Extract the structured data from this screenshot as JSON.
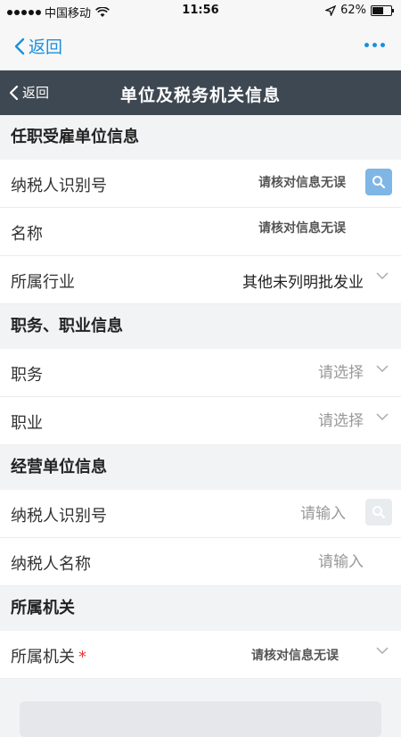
{
  "status_bar": {
    "carrier": "中国移动",
    "time": "11:56",
    "battery_text": "62%",
    "battery_level": 0.62
  },
  "top_nav": {
    "back_label": "返回"
  },
  "app_nav": {
    "back_label": "返回",
    "title": "单位及税务机关信息"
  },
  "sections": {
    "employer": {
      "title": "任职受雇单位信息",
      "taxpayer_id_label": "纳税人识别号",
      "taxpayer_id_value": "请核对信息无误",
      "name_label": "名称",
      "name_value": "请核对信息无误",
      "industry_label": "所属行业",
      "industry_value": "其他未列明批发业"
    },
    "position": {
      "title": "职务、职业信息",
      "duty_label": "职务",
      "duty_value": "请选择",
      "occupation_label": "职业",
      "occupation_value": "请选择"
    },
    "business": {
      "title": "经营单位信息",
      "taxpayer_id_label": "纳税人识别号",
      "taxpayer_id_placeholder": "请输入",
      "taxpayer_name_label": "纳税人名称",
      "taxpayer_name_placeholder": "请输入"
    },
    "authority": {
      "title": "所属机关",
      "authority_label": "所属机关",
      "required_mark": "*",
      "authority_value": "请核对信息无误"
    }
  },
  "colors": {
    "accent": "#1a8fe0",
    "nav_dark": "#3e4852",
    "required": "#e33333"
  }
}
